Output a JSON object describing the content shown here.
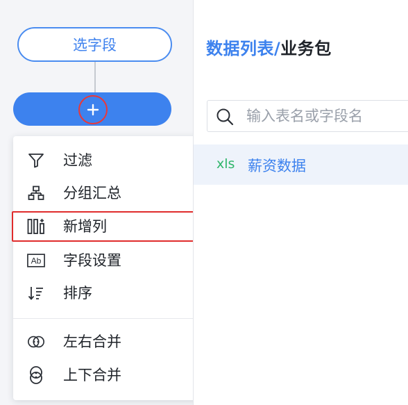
{
  "canvas": {
    "select_node_label": "选字段"
  },
  "menu": {
    "items": [
      {
        "label": "过滤",
        "icon": "filter-icon"
      },
      {
        "label": "分组汇总",
        "icon": "group-summary-icon"
      },
      {
        "label": "新增列",
        "icon": "add-column-icon"
      },
      {
        "label": "字段设置",
        "icon": "field-settings-icon"
      },
      {
        "label": "排序",
        "icon": "sort-icon"
      },
      {
        "label": "左右合并",
        "icon": "merge-horizontal-icon"
      },
      {
        "label": "上下合并",
        "icon": "merge-vertical-icon"
      }
    ],
    "highlighted_item": "新增列"
  },
  "panel": {
    "title_main": "数据列表",
    "title_sep": "/",
    "title_sub": "业务包",
    "search_placeholder": "输入表名或字段名",
    "tables": [
      {
        "type_label": "xls",
        "name": "薪资数据"
      }
    ]
  },
  "colors": {
    "accent": "#3d82ee",
    "highlight": "#e02c2c",
    "xls": "#2fb56a"
  }
}
